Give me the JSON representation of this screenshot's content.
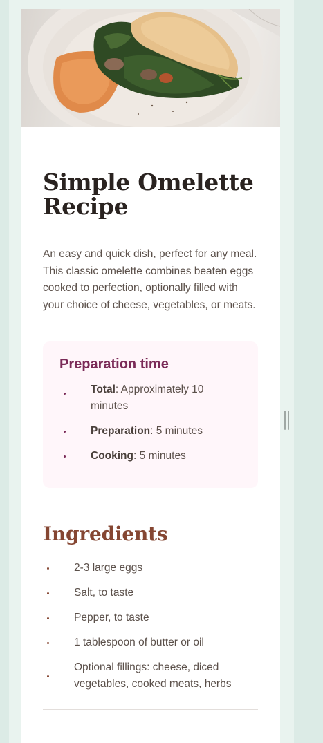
{
  "recipe": {
    "title": "Simple Omelette Recipe",
    "intro": "An easy and quick dish, perfect for any meal. This classic omelette combines beaten eggs cooked to perfection, optionally filled with your choice of cheese, vegetables, or meats.",
    "image_alt": "Omelette on a plate",
    "preparation": {
      "heading": "Preparation time",
      "items": [
        {
          "label": "Total",
          "value": ": Approximately 10 minutes"
        },
        {
          "label": "Preparation",
          "value": ": 5 minutes"
        },
        {
          "label": "Cooking",
          "value": ": 5 minutes"
        }
      ]
    },
    "ingredients": {
      "heading": "Ingredients",
      "items": [
        "2-3 large eggs",
        "Salt, to taste",
        "Pepper, to taste",
        "1 tablespoon of butter or oil",
        "Optional fillings: cheese, diced vegetables, cooked meats, herbs"
      ]
    }
  },
  "colors": {
    "page_bg": "#dcebe6",
    "card_bg": "#ffffff",
    "prep_bg": "#fff6fa",
    "prep_heading": "#7a2a57",
    "ingredients_heading": "#854632",
    "text": "#5b504a",
    "title": "#2a2320"
  }
}
